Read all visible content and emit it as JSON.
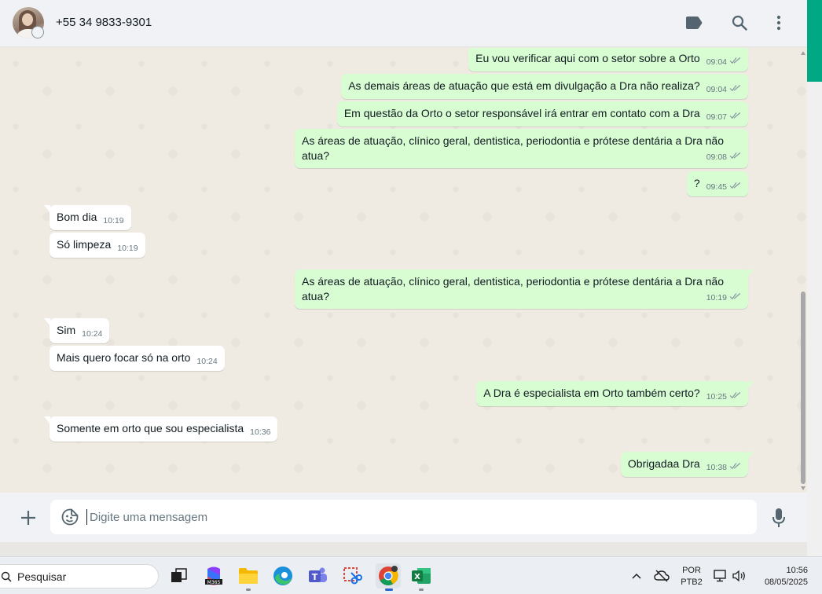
{
  "header": {
    "contact_name": "+55 34 9833-9301"
  },
  "messages": [
    {
      "text": "Eu vou verificar aqui com o setor sobre a Orto",
      "time": "09:04",
      "direction": "out"
    },
    {
      "text": "As demais áreas de atuação que está em divulgação a Dra não realiza?",
      "time": "09:04",
      "direction": "out"
    },
    {
      "text": "Em questão da Orto o setor responsável irá entrar em contato com a Dra",
      "time": "09:07",
      "direction": "out"
    },
    {
      "text": "As áreas de atuação, clínico geral, dentistica, periodontia e prótese dentária a Dra não atua?",
      "time": "09:08",
      "direction": "out"
    },
    {
      "text": "?",
      "time": "09:45",
      "direction": "out"
    },
    {
      "text": "Bom dia",
      "time": "10:19",
      "direction": "in"
    },
    {
      "text": "Só limpeza",
      "time": "10:19",
      "direction": "in"
    },
    {
      "text": "As áreas de atuação, clínico geral, dentistica, periodontia e prótese dentária a Dra não atua?",
      "time": "10:19",
      "direction": "out"
    },
    {
      "text": "Sim",
      "time": "10:24",
      "direction": "in"
    },
    {
      "text": "Mais quero focar só na orto",
      "time": "10:24",
      "direction": "in"
    },
    {
      "text": "A Dra é especialista em Orto também certo?",
      "time": "10:25",
      "direction": "out"
    },
    {
      "text": "Somente em orto que sou especialista",
      "time": "10:36",
      "direction": "in"
    },
    {
      "text": "Obrigadaa Dra",
      "time": "10:38",
      "direction": "out"
    }
  ],
  "composer": {
    "placeholder": "Digite uma mensagem"
  },
  "taskbar": {
    "search_label": "Pesquisar",
    "lang_line1": "POR",
    "lang_line2": "PTB2",
    "time": "10:56",
    "date": "08/05/2025"
  },
  "colors": {
    "outgoing_bubble": "#d9fdd3",
    "incoming_bubble": "#ffffff",
    "accent": "#00a884",
    "chat_background": "#efeae2"
  },
  "icons": [
    "label-icon",
    "search-icon",
    "menu-icon",
    "plus-icon",
    "sticker-icon",
    "mic-icon",
    "double-check-icon"
  ]
}
